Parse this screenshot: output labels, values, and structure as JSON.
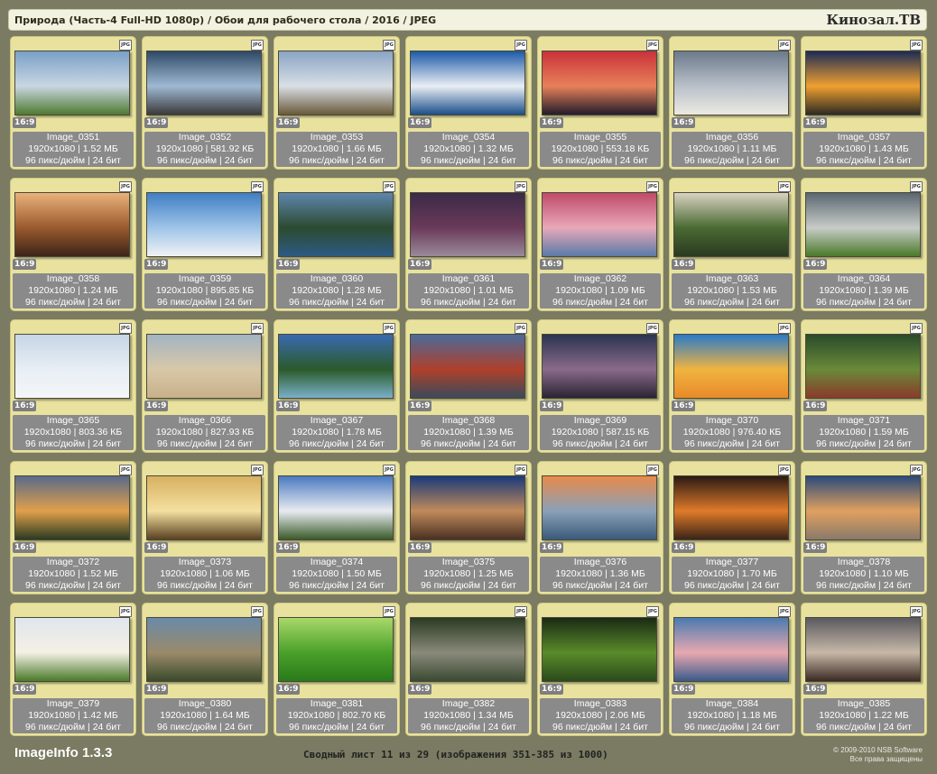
{
  "header": {
    "path": "Природа (Часть-4 Full-HD 1080p) / Обои для рабочего стола / 2016 / JPEG",
    "brand": "Кинозал.ТВ"
  },
  "badge_label": "JPG",
  "images": [
    {
      "name": "Image_0351",
      "dims": "1920x1080 | 1.52 МБ",
      "meta": "96 пикс/дюйм | 24 бит",
      "ratio": "16:9",
      "colors": [
        "#7aa0c8",
        "#c9d6e2",
        "#4f7a30"
      ]
    },
    {
      "name": "Image_0352",
      "dims": "1920x1080 | 581.92 КБ",
      "meta": "96 пикс/дюйм | 24 бит",
      "ratio": "16:9",
      "colors": [
        "#2f4a66",
        "#9fb9d4",
        "#3a3a3a"
      ]
    },
    {
      "name": "Image_0353",
      "dims": "1920x1080 | 1.66 МБ",
      "meta": "96 пикс/дюйм | 24 бит",
      "ratio": "16:9",
      "colors": [
        "#8aa4c4",
        "#d9dfe6",
        "#6a5a3a"
      ]
    },
    {
      "name": "Image_0354",
      "dims": "1920x1080 | 1.32 МБ",
      "meta": "96 пикс/дюйм | 24 бит",
      "ratio": "16:9",
      "colors": [
        "#1e5aa8",
        "#e9eef4",
        "#1b4f8a"
      ]
    },
    {
      "name": "Image_0355",
      "dims": "1920x1080 | 553.18 КБ",
      "meta": "96 пикс/дюйм | 24 бит",
      "ratio": "16:9",
      "colors": [
        "#c9323a",
        "#e7805a",
        "#231c2a"
      ]
    },
    {
      "name": "Image_0356",
      "dims": "1920x1080 | 1.11 МБ",
      "meta": "96 пикс/дюйм | 24 бит",
      "ratio": "16:9",
      "colors": [
        "#6c7a8c",
        "#b9c0c9",
        "#ece9e2"
      ]
    },
    {
      "name": "Image_0357",
      "dims": "1920x1080 | 1.43 МБ",
      "meta": "96 пикс/дюйм | 24 бит",
      "ratio": "16:9",
      "colors": [
        "#1c2c56",
        "#f0a030",
        "#2c2a22"
      ]
    },
    {
      "name": "Image_0358",
      "dims": "1920x1080 | 1.24 МБ",
      "meta": "96 пикс/дюйм | 24 бит",
      "ratio": "16:9",
      "colors": [
        "#e9b27a",
        "#9a5a2e",
        "#3c2418"
      ]
    },
    {
      "name": "Image_0359",
      "dims": "1920x1080 | 895.85 КБ",
      "meta": "96 пикс/дюйм | 24 бит",
      "ratio": "16:9",
      "colors": [
        "#3f7ec4",
        "#9fc4e8",
        "#f0f2f4"
      ]
    },
    {
      "name": "Image_0360",
      "dims": "1920x1080 | 1.28 МБ",
      "meta": "96 пикс/дюйм | 24 бит",
      "ratio": "16:9",
      "colors": [
        "#5e86ad",
        "#2c4a30",
        "#2c5a84"
      ]
    },
    {
      "name": "Image_0361",
      "dims": "1920x1080 | 1.01 МБ",
      "meta": "96 пикс/дюйм | 24 бит",
      "ratio": "16:9",
      "colors": [
        "#3a2a46",
        "#6a3a5a",
        "#9a8a9a"
      ]
    },
    {
      "name": "Image_0362",
      "dims": "1920x1080 | 1.09 МБ",
      "meta": "96 пикс/дюйм | 24 бит",
      "ratio": "16:9",
      "colors": [
        "#c04a6a",
        "#e8a8b8",
        "#5a7aa8"
      ]
    },
    {
      "name": "Image_0363",
      "dims": "1920x1080 | 1.53 МБ",
      "meta": "96 пикс/дюйм | 24 бит",
      "ratio": "16:9",
      "colors": [
        "#d9d2c2",
        "#4a6a32",
        "#2a3a22"
      ]
    },
    {
      "name": "Image_0364",
      "dims": "1920x1080 | 1.39 МБ",
      "meta": "96 пикс/дюйм | 24 бит",
      "ratio": "16:9",
      "colors": [
        "#5a6670",
        "#c8ccc8",
        "#4a7a2a"
      ]
    },
    {
      "name": "Image_0365",
      "dims": "1920x1080 | 803.36 КБ",
      "meta": "96 пикс/дюйм | 24 бит",
      "ratio": "16:9",
      "colors": [
        "#c6d6e6",
        "#e8eef4",
        "#f4f6f8"
      ]
    },
    {
      "name": "Image_0366",
      "dims": "1920x1080 | 827.93 КБ",
      "meta": "96 пикс/дюйм | 24 бит",
      "ratio": "16:9",
      "colors": [
        "#a2b4c2",
        "#d8c8a8",
        "#c8b08a"
      ]
    },
    {
      "name": "Image_0367",
      "dims": "1920x1080 | 1.78 МБ",
      "meta": "96 пикс/дюйм | 24 бит",
      "ratio": "16:9",
      "colors": [
        "#3a6ab0",
        "#2a5a2a",
        "#7ab0c8"
      ]
    },
    {
      "name": "Image_0368",
      "dims": "1920x1080 | 1.39 МБ",
      "meta": "96 пикс/дюйм | 24 бит",
      "ratio": "16:9",
      "colors": [
        "#4a6a9a",
        "#b0402a",
        "#3a4a5a"
      ]
    },
    {
      "name": "Image_0369",
      "dims": "1920x1080 | 587.15 КБ",
      "meta": "96 пикс/дюйм | 24 бит",
      "ratio": "16:9",
      "colors": [
        "#2a3450",
        "#8a6a8a",
        "#2a2432"
      ]
    },
    {
      "name": "Image_0370",
      "dims": "1920x1080 | 976.40 КБ",
      "meta": "96 пикс/дюйм | 24 бит",
      "ratio": "16:9",
      "colors": [
        "#2a7ac8",
        "#f0b440",
        "#e88a2a"
      ]
    },
    {
      "name": "Image_0371",
      "dims": "1920x1080 | 1.59 МБ",
      "meta": "96 пикс/дюйм | 24 бит",
      "ratio": "16:9",
      "colors": [
        "#2a4a2a",
        "#6a8a3a",
        "#8a3a2a"
      ]
    },
    {
      "name": "Image_0372",
      "dims": "1920x1080 | 1.52 МБ",
      "meta": "96 пикс/дюйм | 24 бит",
      "ratio": "16:9",
      "colors": [
        "#5a6a8a",
        "#e0a04a",
        "#2a3a22"
      ]
    },
    {
      "name": "Image_0373",
      "dims": "1920x1080 | 1.06 МБ",
      "meta": "96 пикс/дюйм | 24 бит",
      "ratio": "16:9",
      "colors": [
        "#d8b060",
        "#f4e0a0",
        "#5a4020"
      ]
    },
    {
      "name": "Image_0374",
      "dims": "1920x1080 | 1.50 МБ",
      "meta": "96 пикс/дюйм | 24 бит",
      "ratio": "16:9",
      "colors": [
        "#4a7ac0",
        "#e8ecf0",
        "#3a5a2a"
      ]
    },
    {
      "name": "Image_0375",
      "dims": "1920x1080 | 1.25 МБ",
      "meta": "96 пикс/дюйм | 24 бит",
      "ratio": "16:9",
      "colors": [
        "#1a3a7a",
        "#c08a5a",
        "#4a3022"
      ]
    },
    {
      "name": "Image_0376",
      "dims": "1920x1080 | 1.36 МБ",
      "meta": "96 пикс/дюйм | 24 бит",
      "ratio": "16:9",
      "colors": [
        "#e88a4a",
        "#8aa0b8",
        "#3a5a7a"
      ]
    },
    {
      "name": "Image_0377",
      "dims": "1920x1080 | 1.70 МБ",
      "meta": "96 пикс/дюйм | 24 бит",
      "ratio": "16:9",
      "colors": [
        "#2a1a14",
        "#e07a2a",
        "#3a2418"
      ]
    },
    {
      "name": "Image_0378",
      "dims": "1920x1080 | 1.10 МБ",
      "meta": "96 пикс/дюйм | 24 бит",
      "ratio": "16:9",
      "colors": [
        "#2a4a7a",
        "#e0a060",
        "#8a7a6a"
      ]
    },
    {
      "name": "Image_0379",
      "dims": "1920x1080 | 1.42 МБ",
      "meta": "96 пикс/дюйм | 24 бит",
      "ratio": "16:9",
      "colors": [
        "#e0e6ee",
        "#f4f0e4",
        "#4a7a2a"
      ]
    },
    {
      "name": "Image_0380",
      "dims": "1920x1080 | 1.64 МБ",
      "meta": "96 пикс/дюйм | 24 бит",
      "ratio": "16:9",
      "colors": [
        "#6a8aa8",
        "#9a8a6a",
        "#3a4a2a"
      ]
    },
    {
      "name": "Image_0381",
      "dims": "1920x1080 | 802.70 КБ",
      "meta": "96 пикс/дюйм | 24 бит",
      "ratio": "16:9",
      "colors": [
        "#a8d86a",
        "#4aa02a",
        "#2a7a1a"
      ]
    },
    {
      "name": "Image_0382",
      "dims": "1920x1080 | 1.34 МБ",
      "meta": "96 пикс/дюйм | 24 бит",
      "ratio": "16:9",
      "colors": [
        "#2a3a22",
        "#8a8a7a",
        "#3a4a32"
      ]
    },
    {
      "name": "Image_0383",
      "dims": "1920x1080 | 2.06 МБ",
      "meta": "96 пикс/дюйм | 24 бит",
      "ratio": "16:9",
      "colors": [
        "#1a2a14",
        "#5a8a2a",
        "#2a4a1a"
      ]
    },
    {
      "name": "Image_0384",
      "dims": "1920x1080 | 1.18 МБ",
      "meta": "96 пикс/дюйм | 24 бит",
      "ratio": "16:9",
      "colors": [
        "#4a7ab0",
        "#e8a8b0",
        "#3a5a8a"
      ]
    },
    {
      "name": "Image_0385",
      "dims": "1920x1080 | 1.22 МБ",
      "meta": "96 пикс/дюйм | 24 бит",
      "ratio": "16:9",
      "colors": [
        "#5a5a60",
        "#c8b8a8",
        "#3a2a22"
      ]
    }
  ],
  "footer": {
    "brand": "ImageInfo 1.3.3",
    "summary": "Сводный лист 11 из 29 (изображения 351-385 из 1000)",
    "copyright_line1": "© 2009-2010 NSB Software",
    "copyright_line2": "Все права защищены"
  },
  "colors": {
    "background": "#7a7b62",
    "card": "#e8e29e",
    "info_panel": "#8a8a8a",
    "header_bar": "#f2f2e0"
  }
}
